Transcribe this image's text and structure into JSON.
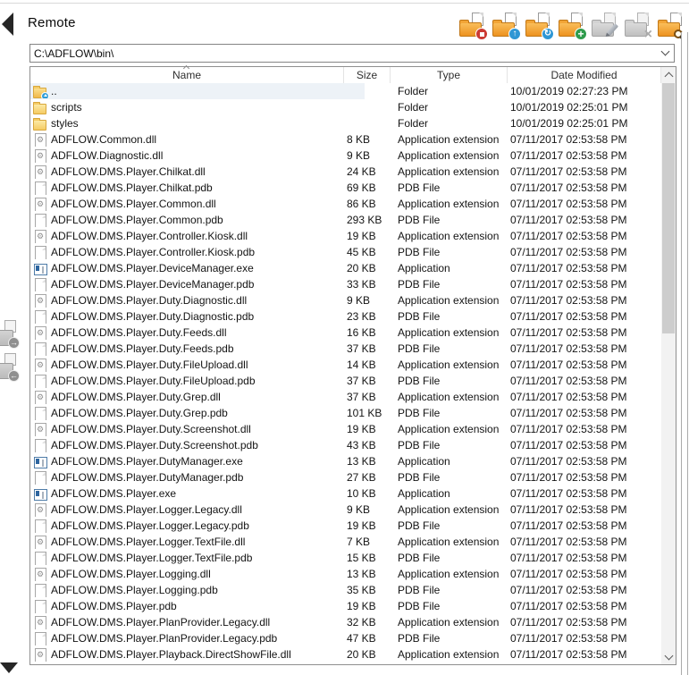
{
  "header": {
    "title": "Remote"
  },
  "toolbar": {
    "buttons": [
      {
        "name": "abort-transfer-button",
        "icon": "folder-stop-icon",
        "style": "stop",
        "enabled": true
      },
      {
        "name": "upload-button",
        "icon": "folder-upload-icon",
        "style": "up",
        "enabled": true
      },
      {
        "name": "refresh-button",
        "icon": "folder-refresh-icon",
        "style": "refresh",
        "enabled": true
      },
      {
        "name": "new-folder-button",
        "icon": "folder-add-icon",
        "style": "add",
        "enabled": true
      },
      {
        "name": "rename-button",
        "icon": "folder-edit-icon",
        "style": "edit",
        "enabled": false
      },
      {
        "name": "delete-button",
        "icon": "folder-delete-icon",
        "style": "del",
        "enabled": false
      },
      {
        "name": "search-button",
        "icon": "folder-search-icon",
        "style": "search",
        "enabled": true
      }
    ]
  },
  "address_bar": {
    "value": "C:\\ADFLOW\\bin\\"
  },
  "columns": [
    {
      "label": "Name"
    },
    {
      "label": "Size"
    },
    {
      "label": "Type"
    },
    {
      "label": "Date Modified"
    }
  ],
  "sort": {
    "column": "Name",
    "direction": "ascending"
  },
  "side_buttons": [
    {
      "name": "transfer-right-button",
      "arrow": "→"
    },
    {
      "name": "transfer-left-button",
      "arrow": "←"
    }
  ],
  "files": [
    {
      "name": "..",
      "size": "",
      "type": "Folder",
      "date": "10/01/2019 02:27:23 PM",
      "icon": "folder-up",
      "highlighted": true
    },
    {
      "name": "scripts",
      "size": "",
      "type": "Folder",
      "date": "10/01/2019 02:25:01 PM",
      "icon": "folder"
    },
    {
      "name": "styles",
      "size": "",
      "type": "Folder",
      "date": "10/01/2019 02:25:01 PM",
      "icon": "folder"
    },
    {
      "name": "ADFLOW.Common.dll",
      "size": "8 KB",
      "type": "Application extension",
      "date": "07/11/2017 02:53:58 PM",
      "icon": "dll"
    },
    {
      "name": "ADFLOW.Diagnostic.dll",
      "size": "9 KB",
      "type": "Application extension",
      "date": "07/11/2017 02:53:58 PM",
      "icon": "dll"
    },
    {
      "name": "ADFLOW.DMS.Player.Chilkat.dll",
      "size": "24 KB",
      "type": "Application extension",
      "date": "07/11/2017 02:53:58 PM",
      "icon": "dll"
    },
    {
      "name": "ADFLOW.DMS.Player.Chilkat.pdb",
      "size": "69 KB",
      "type": "PDB File",
      "date": "07/11/2017 02:53:58 PM",
      "icon": "pdb"
    },
    {
      "name": "ADFLOW.DMS.Player.Common.dll",
      "size": "86 KB",
      "type": "Application extension",
      "date": "07/11/2017 02:53:58 PM",
      "icon": "dll"
    },
    {
      "name": "ADFLOW.DMS.Player.Common.pdb",
      "size": "293 KB",
      "type": "PDB File",
      "date": "07/11/2017 02:53:58 PM",
      "icon": "pdb"
    },
    {
      "name": "ADFLOW.DMS.Player.Controller.Kiosk.dll",
      "size": "19 KB",
      "type": "Application extension",
      "date": "07/11/2017 02:53:58 PM",
      "icon": "dll"
    },
    {
      "name": "ADFLOW.DMS.Player.Controller.Kiosk.pdb",
      "size": "45 KB",
      "type": "PDB File",
      "date": "07/11/2017 02:53:58 PM",
      "icon": "pdb"
    },
    {
      "name": "ADFLOW.DMS.Player.DeviceManager.exe",
      "size": "20 KB",
      "type": "Application",
      "date": "07/11/2017 02:53:58 PM",
      "icon": "exe"
    },
    {
      "name": "ADFLOW.DMS.Player.DeviceManager.pdb",
      "size": "33 KB",
      "type": "PDB File",
      "date": "07/11/2017 02:53:58 PM",
      "icon": "pdb"
    },
    {
      "name": "ADFLOW.DMS.Player.Duty.Diagnostic.dll",
      "size": "9 KB",
      "type": "Application extension",
      "date": "07/11/2017 02:53:58 PM",
      "icon": "dll"
    },
    {
      "name": "ADFLOW.DMS.Player.Duty.Diagnostic.pdb",
      "size": "23 KB",
      "type": "PDB File",
      "date": "07/11/2017 02:53:58 PM",
      "icon": "pdb"
    },
    {
      "name": "ADFLOW.DMS.Player.Duty.Feeds.dll",
      "size": "16 KB",
      "type": "Application extension",
      "date": "07/11/2017 02:53:58 PM",
      "icon": "dll"
    },
    {
      "name": "ADFLOW.DMS.Player.Duty.Feeds.pdb",
      "size": "37 KB",
      "type": "PDB File",
      "date": "07/11/2017 02:53:58 PM",
      "icon": "pdb"
    },
    {
      "name": "ADFLOW.DMS.Player.Duty.FileUpload.dll",
      "size": "14 KB",
      "type": "Application extension",
      "date": "07/11/2017 02:53:58 PM",
      "icon": "dll"
    },
    {
      "name": "ADFLOW.DMS.Player.Duty.FileUpload.pdb",
      "size": "37 KB",
      "type": "PDB File",
      "date": "07/11/2017 02:53:58 PM",
      "icon": "pdb"
    },
    {
      "name": "ADFLOW.DMS.Player.Duty.Grep.dll",
      "size": "37 KB",
      "type": "Application extension",
      "date": "07/11/2017 02:53:58 PM",
      "icon": "dll"
    },
    {
      "name": "ADFLOW.DMS.Player.Duty.Grep.pdb",
      "size": "101 KB",
      "type": "PDB File",
      "date": "07/11/2017 02:53:58 PM",
      "icon": "pdb"
    },
    {
      "name": "ADFLOW.DMS.Player.Duty.Screenshot.dll",
      "size": "19 KB",
      "type": "Application extension",
      "date": "07/11/2017 02:53:58 PM",
      "icon": "dll"
    },
    {
      "name": "ADFLOW.DMS.Player.Duty.Screenshot.pdb",
      "size": "43 KB",
      "type": "PDB File",
      "date": "07/11/2017 02:53:58 PM",
      "icon": "pdb"
    },
    {
      "name": "ADFLOW.DMS.Player.DutyManager.exe",
      "size": "13 KB",
      "type": "Application",
      "date": "07/11/2017 02:53:58 PM",
      "icon": "exe"
    },
    {
      "name": "ADFLOW.DMS.Player.DutyManager.pdb",
      "size": "27 KB",
      "type": "PDB File",
      "date": "07/11/2017 02:53:58 PM",
      "icon": "pdb"
    },
    {
      "name": "ADFLOW.DMS.Player.exe",
      "size": "10 KB",
      "type": "Application",
      "date": "07/11/2017 02:53:58 PM",
      "icon": "exe"
    },
    {
      "name": "ADFLOW.DMS.Player.Logger.Legacy.dll",
      "size": "9 KB",
      "type": "Application extension",
      "date": "07/11/2017 02:53:58 PM",
      "icon": "dll"
    },
    {
      "name": "ADFLOW.DMS.Player.Logger.Legacy.pdb",
      "size": "19 KB",
      "type": "PDB File",
      "date": "07/11/2017 02:53:58 PM",
      "icon": "pdb"
    },
    {
      "name": "ADFLOW.DMS.Player.Logger.TextFile.dll",
      "size": "7 KB",
      "type": "Application extension",
      "date": "07/11/2017 02:53:58 PM",
      "icon": "dll"
    },
    {
      "name": "ADFLOW.DMS.Player.Logger.TextFile.pdb",
      "size": "15 KB",
      "type": "PDB File",
      "date": "07/11/2017 02:53:58 PM",
      "icon": "pdb"
    },
    {
      "name": "ADFLOW.DMS.Player.Logging.dll",
      "size": "13 KB",
      "type": "Application extension",
      "date": "07/11/2017 02:53:58 PM",
      "icon": "dll"
    },
    {
      "name": "ADFLOW.DMS.Player.Logging.pdb",
      "size": "35 KB",
      "type": "PDB File",
      "date": "07/11/2017 02:53:58 PM",
      "icon": "pdb"
    },
    {
      "name": "ADFLOW.DMS.Player.pdb",
      "size": "19 KB",
      "type": "PDB File",
      "date": "07/11/2017 02:53:58 PM",
      "icon": "pdb"
    },
    {
      "name": "ADFLOW.DMS.Player.PlanProvider.Legacy.dll",
      "size": "32 KB",
      "type": "Application extension",
      "date": "07/11/2017 02:53:58 PM",
      "icon": "dll"
    },
    {
      "name": "ADFLOW.DMS.Player.PlanProvider.Legacy.pdb",
      "size": "47 KB",
      "type": "PDB File",
      "date": "07/11/2017 02:53:58 PM",
      "icon": "pdb"
    },
    {
      "name": "ADFLOW.DMS.Player.Playback.DirectShowFile.dll",
      "size": "20 KB",
      "type": "Application extension",
      "date": "07/11/2017 02:53:58 PM",
      "icon": "dll"
    }
  ],
  "partial_row": {
    "icon": "pdb"
  },
  "colors": {
    "folder_orange": "#ED9220",
    "folder_yellow": "#F5CB64",
    "badge_red": "#CB3A33",
    "badge_blue": "#2E96D4",
    "badge_green": "#2F9C4C",
    "row_highlight": "#EDF2F7",
    "scrollbar_thumb": "#CDCDCD"
  }
}
